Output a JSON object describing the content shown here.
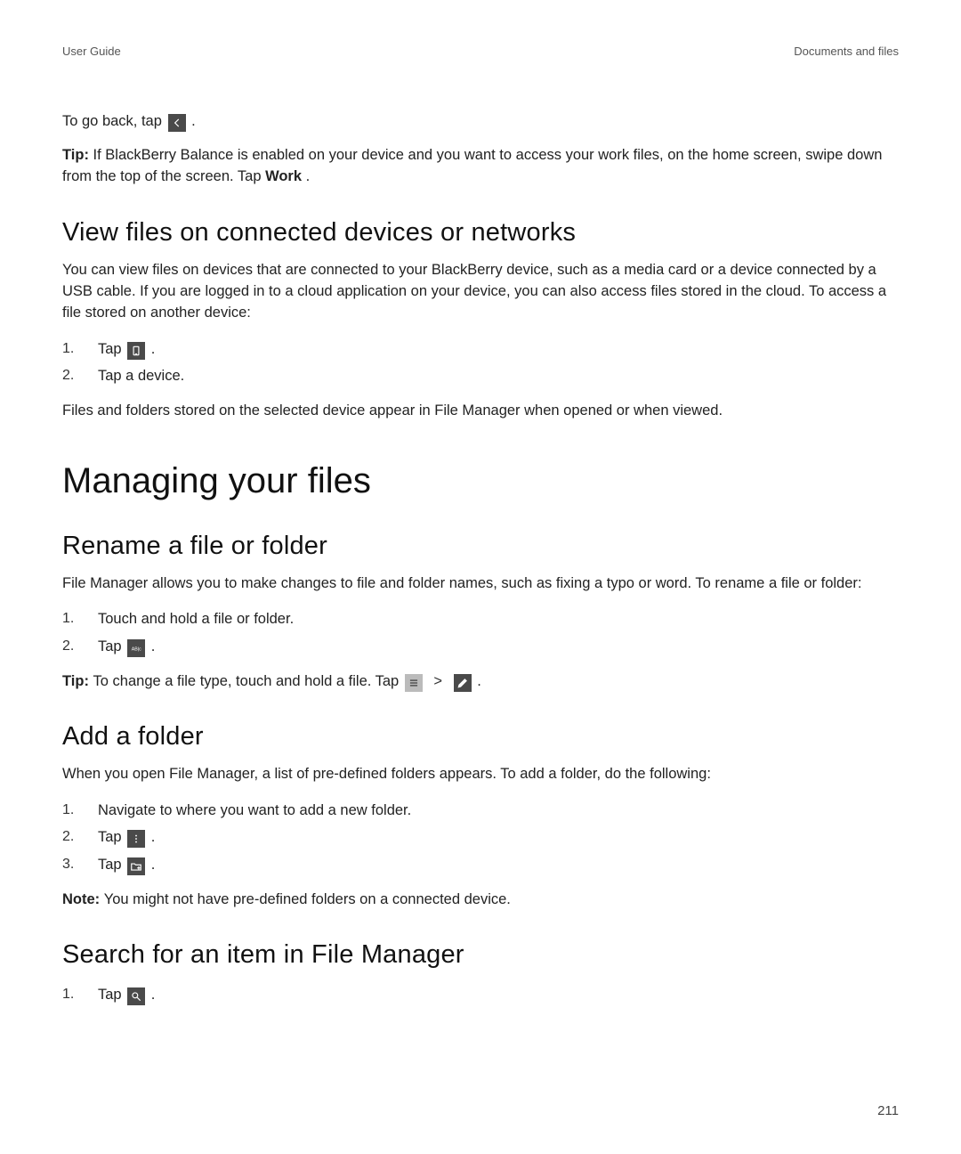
{
  "header": {
    "left": "User Guide",
    "right": "Documents and files"
  },
  "intro": {
    "go_back_pre": "To go back, tap ",
    "tip_label": "Tip: ",
    "tip_text_1": "If BlackBerry Balance is enabled on your device and you want to access your work files, on the home screen, swipe down from the top of the screen. Tap ",
    "tip_work": "Work",
    "tip_text_2": " ."
  },
  "view_files": {
    "heading": "View files on connected devices or networks",
    "para": "You can view files on devices that are connected to your BlackBerry device, such as a media card or a device connected by a USB cable. If you are logged in to a cloud application on your device, you can also access files stored in the cloud. To access a file stored on another device:",
    "steps": {
      "s1_pre": "Tap ",
      "s2": "Tap a device."
    },
    "after": "Files and folders stored on the selected device appear in File Manager when opened or when viewed."
  },
  "chapter": "Managing your files",
  "rename": {
    "heading": "Rename a file or folder",
    "para": "File Manager allows you to make changes to file and folder names, such as fixing a typo or word. To rename a file or folder:",
    "steps": {
      "s1": "Touch and hold a file or folder.",
      "s2_pre": "Tap "
    },
    "tip_label": "Tip: ",
    "tip_text": "To change a file type, touch and hold a file. Tap "
  },
  "add_folder": {
    "heading": "Add a folder",
    "para": "When you open File Manager, a list of pre-defined folders appears. To add a folder, do the following:",
    "steps": {
      "s1": "Navigate to where you want to add a new folder.",
      "s2_pre": "Tap ",
      "s3_pre": "Tap "
    },
    "note_label": "Note: ",
    "note_text": "You might not have pre-defined folders on a connected device."
  },
  "search": {
    "heading": "Search for an item in File Manager",
    "steps": {
      "s1_pre": "Tap "
    }
  },
  "page_number": "211"
}
